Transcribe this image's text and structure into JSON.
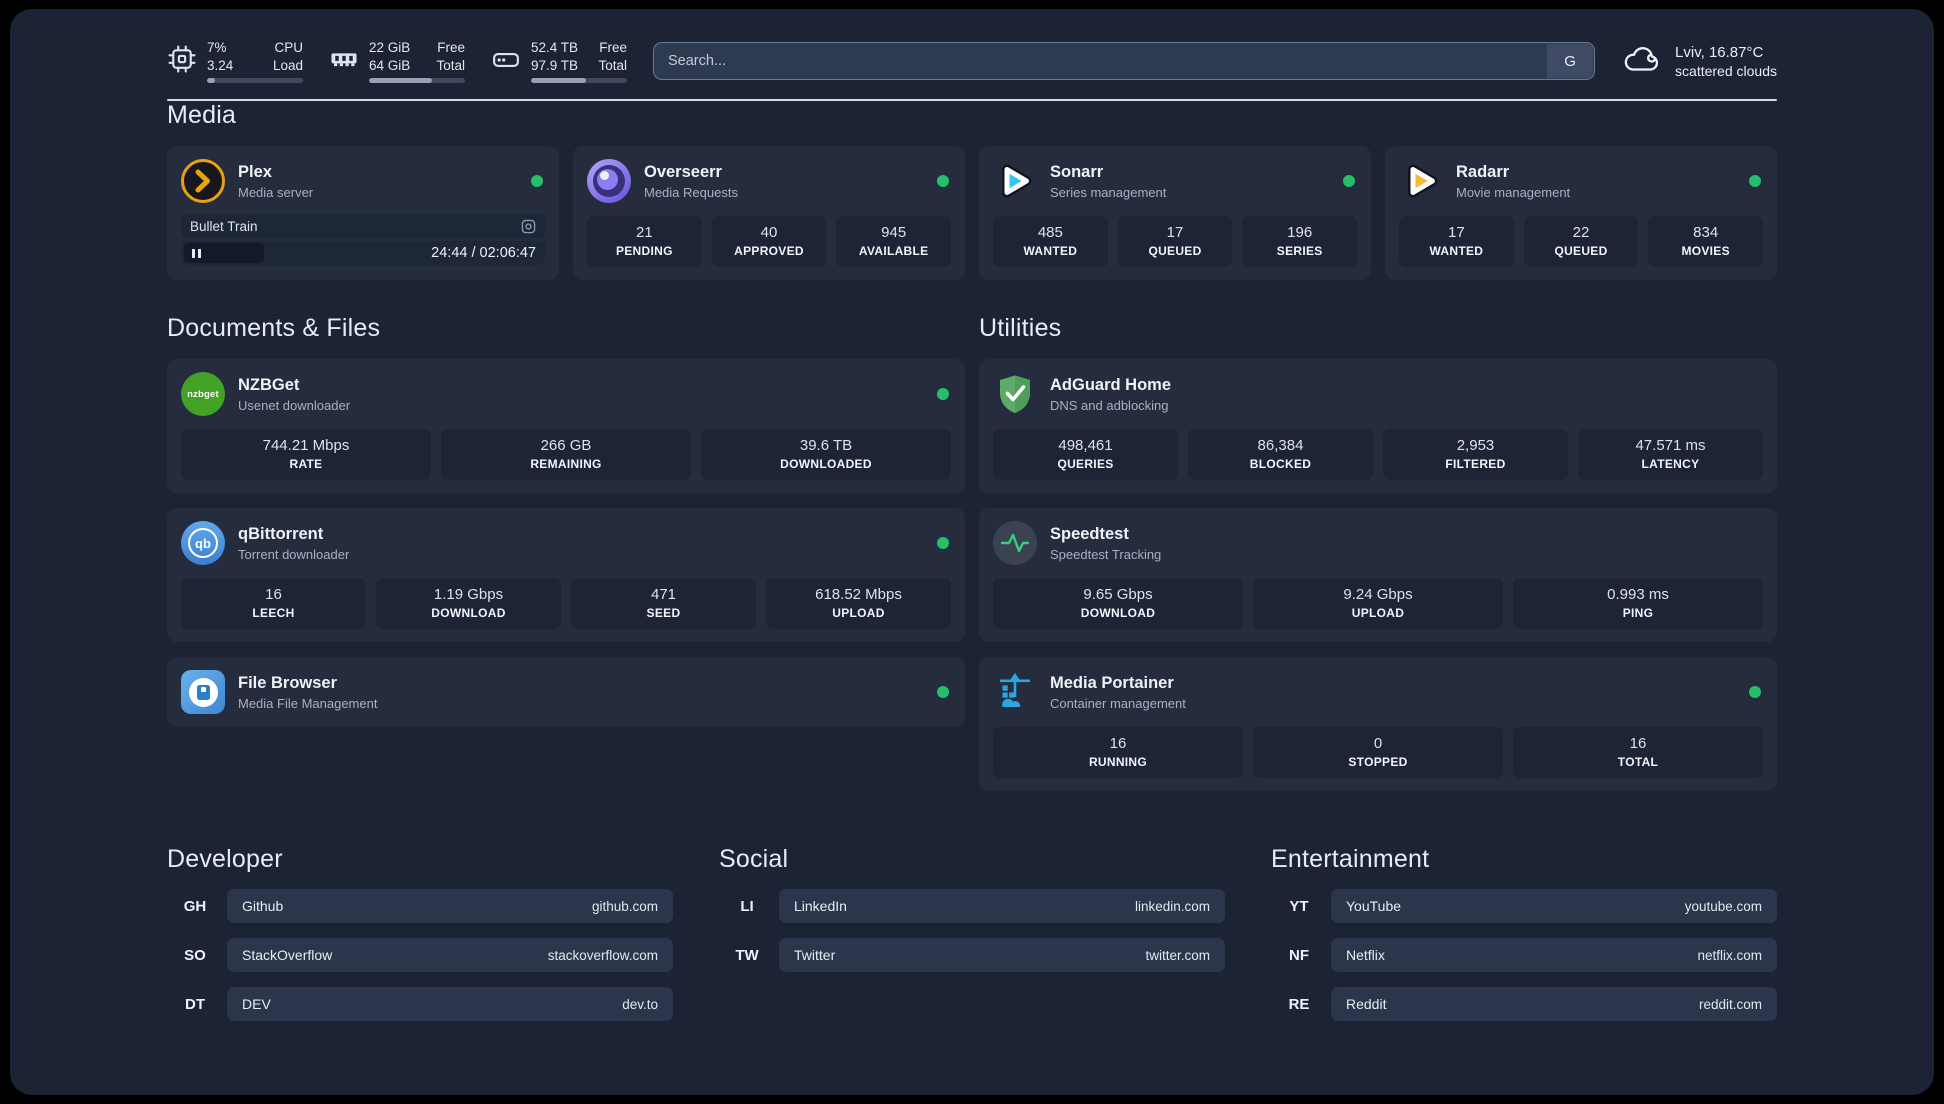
{
  "topbar": {
    "resources": [
      {
        "icon": "cpu-icon",
        "rows": [
          {
            "value": "7%",
            "label": "CPU"
          },
          {
            "value": "3.24",
            "label": "Load"
          }
        ],
        "progress": 8
      },
      {
        "icon": "ram-icon",
        "rows": [
          {
            "value": "22 GiB",
            "label": "Free"
          },
          {
            "value": "64 GiB",
            "label": "Total"
          }
        ],
        "progress": 66
      },
      {
        "icon": "disk-icon",
        "rows": [
          {
            "value": "52.4 TB",
            "label": "Free"
          },
          {
            "value": "97.9 TB",
            "label": "Total"
          }
        ],
        "progress": 57
      }
    ],
    "search": {
      "placeholder": "Search...",
      "button_label": "G"
    },
    "weather": {
      "location_temp": "Lviv, 16.87°C",
      "condition": "scattered clouds"
    }
  },
  "sections": {
    "media": "Media",
    "documents": "Documents & Files",
    "utilities": "Utilities",
    "developer": "Developer",
    "social": "Social",
    "entertainment": "Entertainment"
  },
  "services": {
    "plex": {
      "name": "Plex",
      "subtitle": "Media server",
      "online": true,
      "player": {
        "title": "Bullet Train",
        "time": "24:44 / 02:06:47"
      }
    },
    "overseerr": {
      "name": "Overseerr",
      "subtitle": "Media Requests",
      "online": true,
      "stats": [
        {
          "value": "21",
          "label": "PENDING"
        },
        {
          "value": "40",
          "label": "APPROVED"
        },
        {
          "value": "945",
          "label": "AVAILABLE"
        }
      ]
    },
    "sonarr": {
      "name": "Sonarr",
      "subtitle": "Series management",
      "online": true,
      "stats": [
        {
          "value": "485",
          "label": "WANTED"
        },
        {
          "value": "17",
          "label": "QUEUED"
        },
        {
          "value": "196",
          "label": "SERIES"
        }
      ]
    },
    "radarr": {
      "name": "Radarr",
      "subtitle": "Movie management",
      "online": true,
      "stats": [
        {
          "value": "17",
          "label": "WANTED"
        },
        {
          "value": "22",
          "label": "QUEUED"
        },
        {
          "value": "834",
          "label": "MOVIES"
        }
      ]
    },
    "nzbget": {
      "name": "NZBGet",
      "subtitle": "Usenet downloader",
      "online": true,
      "icon_text": "nzbget",
      "stats": [
        {
          "value": "744.21 Mbps",
          "label": "RATE"
        },
        {
          "value": "266 GB",
          "label": "REMAINING"
        },
        {
          "value": "39.6 TB",
          "label": "DOWNLOADED"
        }
      ]
    },
    "qbittorrent": {
      "name": "qBittorrent",
      "subtitle": "Torrent downloader",
      "online": true,
      "icon_text": "qb",
      "stats": [
        {
          "value": "16",
          "label": "LEECH"
        },
        {
          "value": "1.19 Gbps",
          "label": "DOWNLOAD"
        },
        {
          "value": "471",
          "label": "SEED"
        },
        {
          "value": "618.52 Mbps",
          "label": "UPLOAD"
        }
      ]
    },
    "filebrowser": {
      "name": "File Browser",
      "subtitle": "Media File Management",
      "online": true
    },
    "adguard": {
      "name": "AdGuard Home",
      "subtitle": "DNS and adblocking",
      "stats": [
        {
          "value": "498,461",
          "label": "QUERIES"
        },
        {
          "value": "86,384",
          "label": "BLOCKED"
        },
        {
          "value": "2,953",
          "label": "FILTERED"
        },
        {
          "value": "47.571 ms",
          "label": "LATENCY"
        }
      ]
    },
    "speedtest": {
      "name": "Speedtest",
      "subtitle": "Speedtest Tracking",
      "stats": [
        {
          "value": "9.65 Gbps",
          "label": "DOWNLOAD"
        },
        {
          "value": "9.24 Gbps",
          "label": "UPLOAD"
        },
        {
          "value": "0.993 ms",
          "label": "PING"
        }
      ]
    },
    "portainer": {
      "name": "Media Portainer",
      "subtitle": "Container management",
      "online": true,
      "stats": [
        {
          "value": "16",
          "label": "RUNNING"
        },
        {
          "value": "0",
          "label": "STOPPED"
        },
        {
          "value": "16",
          "label": "TOTAL"
        }
      ]
    }
  },
  "bookmarks": {
    "developer": [
      {
        "abbr": "GH",
        "name": "Github",
        "url": "github.com"
      },
      {
        "abbr": "SO",
        "name": "StackOverflow",
        "url": "stackoverflow.com"
      },
      {
        "abbr": "DT",
        "name": "DEV",
        "url": "dev.to"
      }
    ],
    "social": [
      {
        "abbr": "LI",
        "name": "LinkedIn",
        "url": "linkedin.com"
      },
      {
        "abbr": "TW",
        "name": "Twitter",
        "url": "twitter.com"
      }
    ],
    "entertainment": [
      {
        "abbr": "YT",
        "name": "YouTube",
        "url": "youtube.com"
      },
      {
        "abbr": "NF",
        "name": "Netflix",
        "url": "netflix.com"
      },
      {
        "abbr": "RE",
        "name": "Reddit",
        "url": "reddit.com"
      }
    ]
  },
  "colors": {
    "background": "#1b2334",
    "card": "#242c3e",
    "stat_box": "#1c2435",
    "status_online": "#26be6a",
    "plex_brand": "#e8a10f",
    "overseerr_brand": "#6551dd",
    "sonarr_brand": "#35c5f4",
    "radarr_brand": "#f7b931",
    "nzbget_brand": "#43a125",
    "qbittorrent_brand": "#4b92da",
    "filebrowser_brand": "#3f86d0",
    "adguard_brand": "#5cab67",
    "speedtest_accent": "#35d07e",
    "portainer_brand": "#2aa7e0"
  }
}
